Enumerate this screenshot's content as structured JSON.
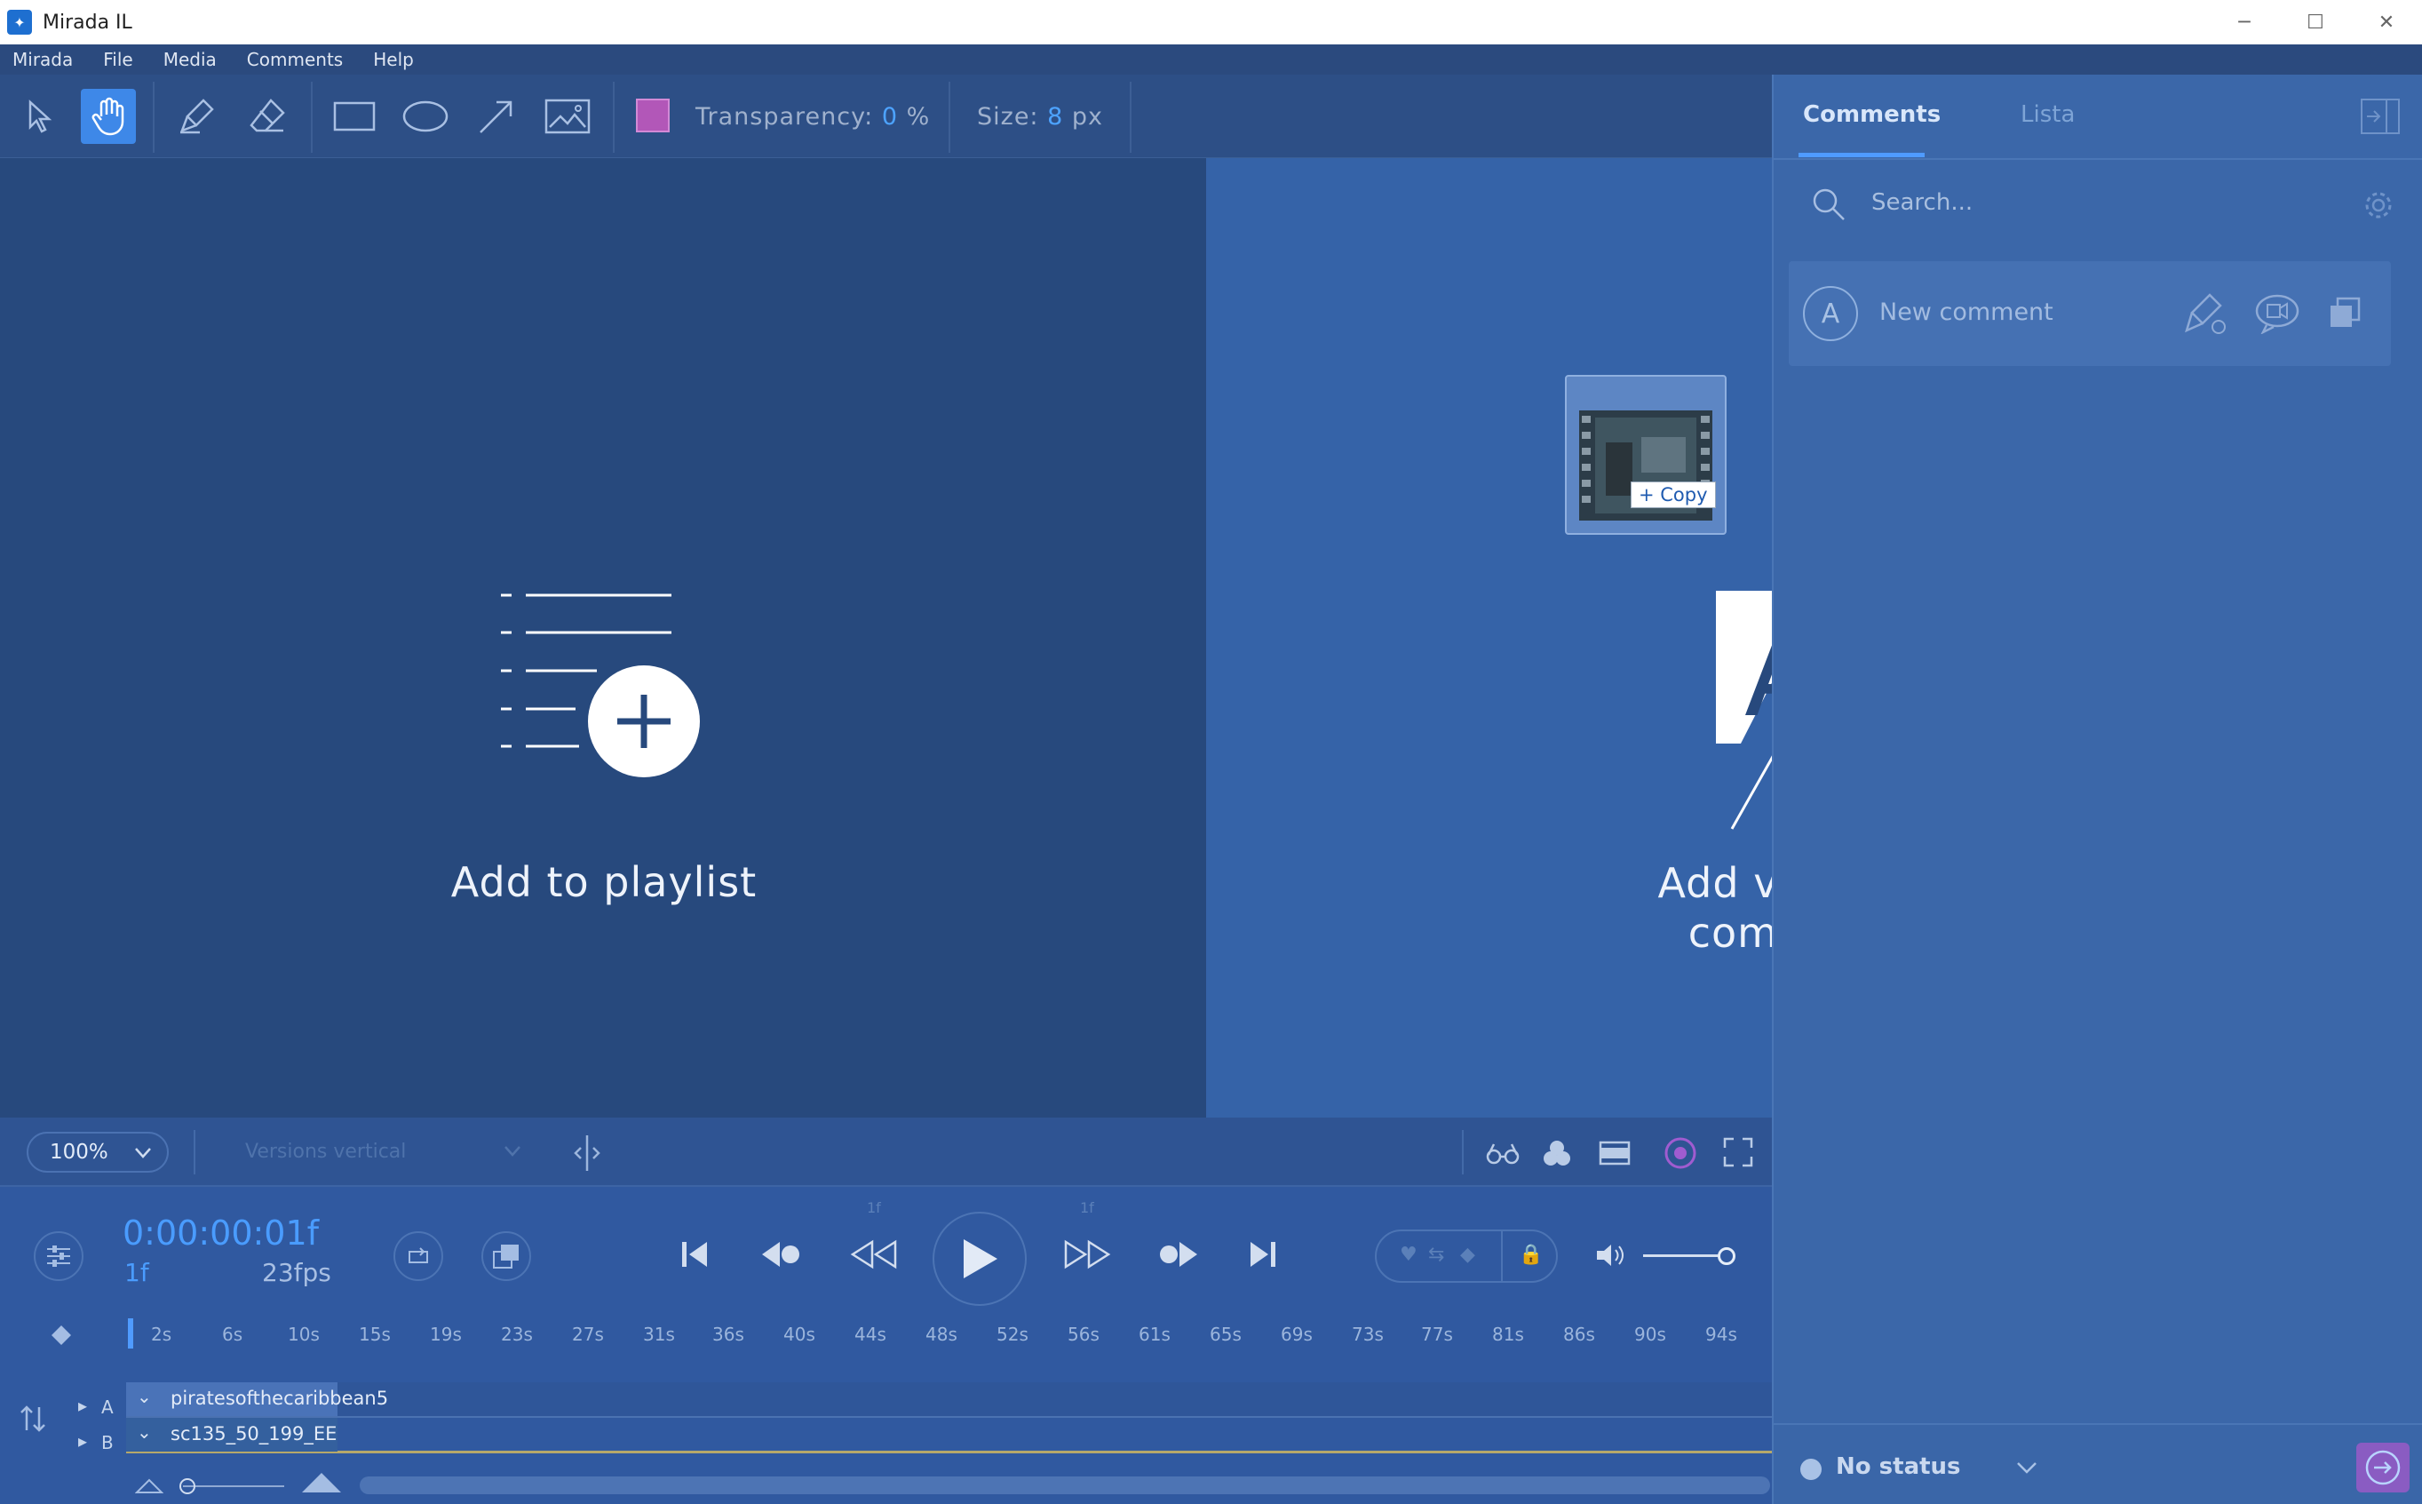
{
  "window": {
    "title": "Mirada IL",
    "controls": {
      "minimize": "─",
      "maximize": "☐",
      "close": "✕"
    }
  },
  "menu": [
    "Mirada",
    "File",
    "Media",
    "Comments",
    "Help"
  ],
  "toolbar": {
    "transparency_label": "Transparency:",
    "transparency_value": "0",
    "transparency_unit": "%",
    "size_label": "Size:",
    "size_value": "8",
    "size_unit": "px",
    "color": "#b257b8"
  },
  "canvas": {
    "playlist_label": "Add to playlist",
    "comparison_label_line1": "Add version to",
    "comparison_label_line2": "comparison",
    "drag_copy_label": "+ Copy"
  },
  "panel": {
    "tabs": [
      "Comments",
      "Lista"
    ],
    "search_placeholder": "Search...",
    "avatar_letter": "A",
    "new_comment_placeholder": "New comment",
    "status": "No status"
  },
  "viewbar": {
    "zoom": "100%",
    "layout": "Versions vertical"
  },
  "transport": {
    "timecode": "0:00:00:01f",
    "frame": "1f",
    "fps": "23fps",
    "prev_step": "1f",
    "next_step": "1f"
  },
  "timeline": {
    "ticks": [
      "2s",
      "6s",
      "10s",
      "15s",
      "19s",
      "23s",
      "27s",
      "31s",
      "36s",
      "40s",
      "44s",
      "48s",
      "52s",
      "56s",
      "61s",
      "65s",
      "69s",
      "73s",
      "77s",
      "81s",
      "86s",
      "90s",
      "94s"
    ],
    "tracks": [
      {
        "letter": "A",
        "name": "piratesofthecaribbean5"
      },
      {
        "letter": "B",
        "name": "sc135_50_199_EE"
      }
    ]
  },
  "colors": {
    "accent": "#4a9cff",
    "bg_dark": "#27497d",
    "bg_light": "#3563a8"
  }
}
